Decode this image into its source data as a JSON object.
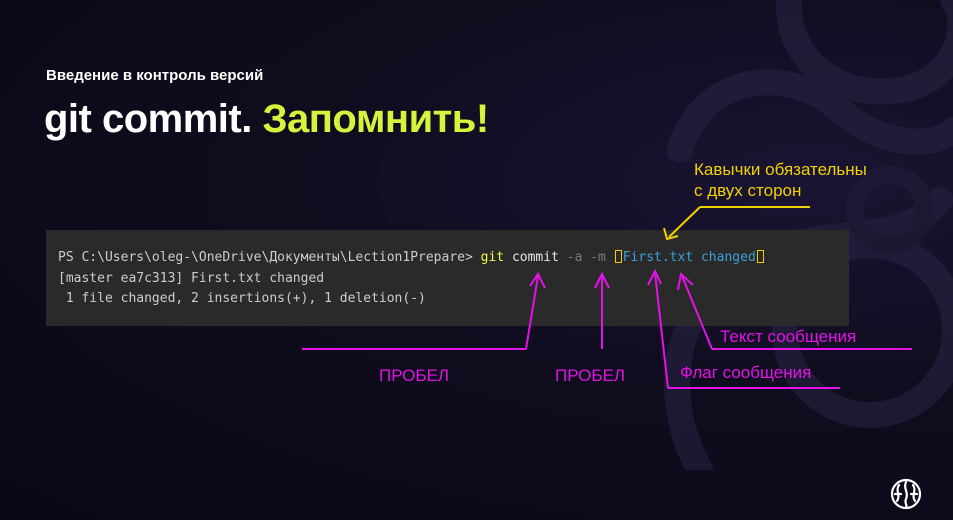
{
  "slide": {
    "subtitle": "Введение в контроль версий",
    "title_main": "git commit.",
    "title_accent": "Запомнить!"
  },
  "terminal": {
    "prompt": "PS C:\\Users\\oleg-\\OneDrive\\Документы\\Lection1Prepare> ",
    "git": "git",
    "commit": "commit",
    "flag_a": "-a",
    "flag_m": "-m",
    "message": "First.txt changed",
    "output_line1": "[master ea7c313] First.txt changed",
    "output_line2": " 1 file changed, 2 insertions(+), 1 deletion(-)"
  },
  "annotations": {
    "quotes_line1": "Кавычки обязательны",
    "quotes_line2": "с двух сторон",
    "message_text": "Текст сообщения",
    "space_1": "ПРОБЕЛ",
    "space_2": "ПРОБЕЛ",
    "message_flag": "Флаг сообщения"
  },
  "colors": {
    "accent": "#d4f53c",
    "annotation_yellow": "#f0d100",
    "annotation_magenta": "#e312e6",
    "terminal_bg": "#2a2a2a"
  },
  "icons": {
    "background": "brain-logo-watermark",
    "corner": "brain-logo-icon"
  }
}
